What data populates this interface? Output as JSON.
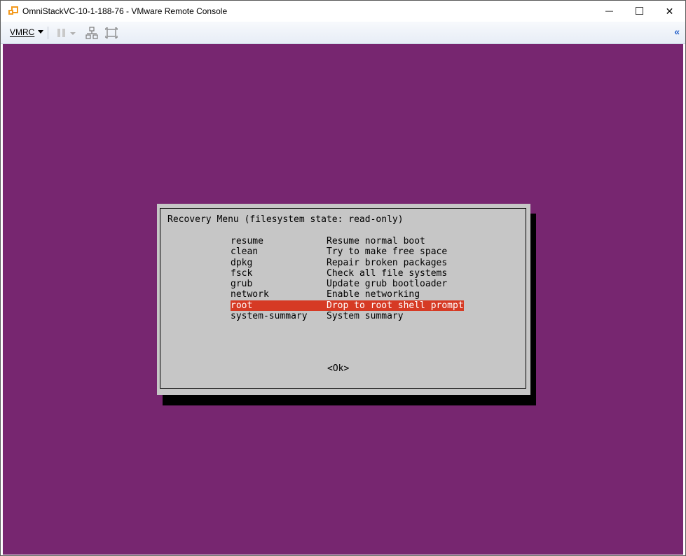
{
  "window": {
    "title": "OmniStackVC-10-1-188-76 - VMware Remote Console",
    "minimize_glyph": "—",
    "maximize_glyph": "☐",
    "close_glyph": "✕"
  },
  "toolbar": {
    "vmrc_label": "VMRC",
    "icons": [
      "vmrc-dropdown-icon",
      "pause-icon",
      "pause-dropdown-icon",
      "network-icon",
      "fullscreen-icon",
      "collapse-icon"
    ],
    "collapse_glyph": "«"
  },
  "console": {
    "background_color": "#772670",
    "dialog": {
      "title": "Recovery Menu (filesystem state: read-only)",
      "items": [
        {
          "key": "resume",
          "description": "Resume normal boot"
        },
        {
          "key": "clean",
          "description": "Try to make free space"
        },
        {
          "key": "dpkg",
          "description": "Repair broken packages"
        },
        {
          "key": "fsck",
          "description": "Check all file systems"
        },
        {
          "key": "grub",
          "description": "Update grub bootloader"
        },
        {
          "key": "network",
          "description": "Enable networking"
        },
        {
          "key": "root",
          "description": "Drop to root shell prompt"
        },
        {
          "key": "system-summary",
          "description": "System summary"
        }
      ],
      "selected_index": 6,
      "selection_color": "#d63a24",
      "ok_label": "<Ok>"
    }
  }
}
